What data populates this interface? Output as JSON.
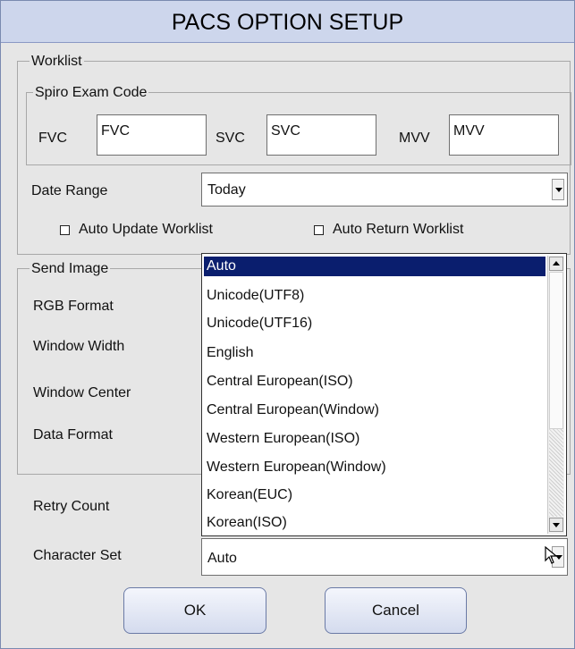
{
  "window": {
    "title": "PACS OPTION SETUP"
  },
  "worklist": {
    "legend": "Worklist",
    "spiro": {
      "legend": "Spiro Exam Code",
      "fvc": {
        "label": "FVC",
        "value": "FVC"
      },
      "svc": {
        "label": "SVC",
        "value": "SVC"
      },
      "mvv": {
        "label": "MVV",
        "value": "MVV"
      }
    },
    "date_range": {
      "label": "Date Range",
      "value": "Today"
    },
    "auto_update": {
      "label": "Auto Update Worklist",
      "checked": false
    },
    "auto_return": {
      "label": "Auto Return Worklist",
      "checked": false
    }
  },
  "send_image": {
    "legend": "Send Image",
    "rgb_format": "RGB Format",
    "window_width": "Window Width",
    "window_center": "Window Center",
    "data_format": "Data Format"
  },
  "retry_count": {
    "label": "Retry Count"
  },
  "character_set": {
    "label": "Character Set",
    "value": "Auto",
    "options": [
      "Auto",
      "Unicode(UTF8)",
      "Unicode(UTF16)",
      "English",
      "Central European(ISO)",
      "Central European(Window)",
      "Western European(ISO)",
      "Western European(Window)",
      "Korean(EUC)",
      "Korean(ISO)"
    ],
    "selected_index": 0
  },
  "buttons": {
    "ok": "OK",
    "cancel": "Cancel"
  },
  "icons": {
    "dropdown": "chevron-down-icon",
    "scroll_up": "arrow-up-icon",
    "scroll_down": "arrow-down-icon",
    "cursor": "mouse-pointer-icon"
  }
}
